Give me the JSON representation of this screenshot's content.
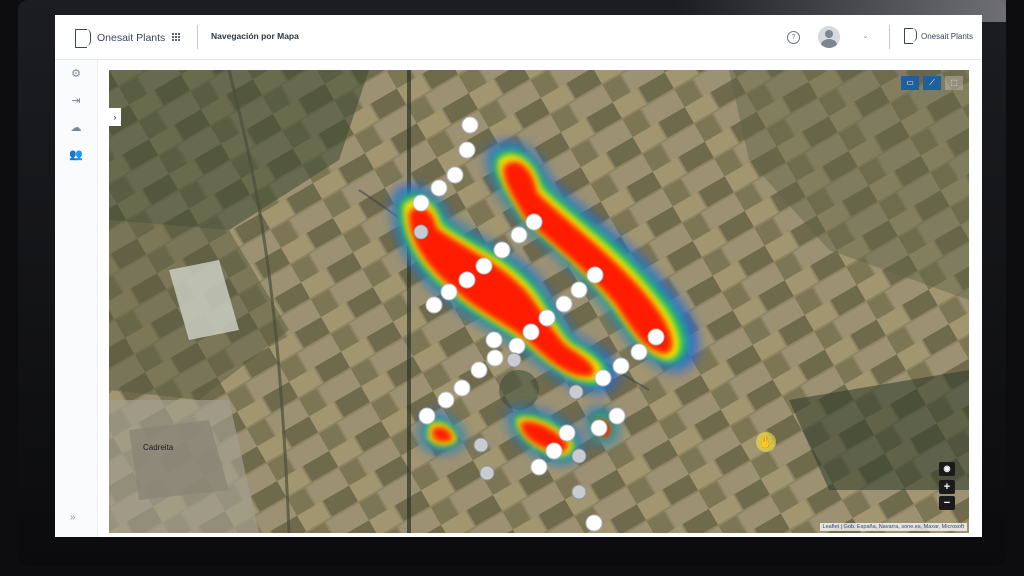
{
  "app": {
    "brand_name": "Onesait Plants",
    "page_title": "Navegación por Mapa",
    "brand_name_right": "Onesait Plants",
    "help_glyph": "?",
    "chevron_glyph": "⌄"
  },
  "sidebar": {
    "items": [
      {
        "icon": "plants-icon",
        "glyph": "⚙"
      },
      {
        "icon": "export-icon",
        "glyph": "⇥"
      },
      {
        "icon": "cloud-sync-icon",
        "glyph": "☁"
      },
      {
        "icon": "users-icon",
        "glyph": "👥"
      }
    ],
    "expand_glyph": "»"
  },
  "map": {
    "collapse_glyph": "›",
    "tools": [
      {
        "name": "monitor-tool-icon",
        "glyph": "▭",
        "active": true
      },
      {
        "name": "draw-line-tool-icon",
        "glyph": "⟋",
        "active": true
      },
      {
        "name": "select-area-tool-icon",
        "glyph": "⬚",
        "active": false
      }
    ],
    "zoom_in_label": "+",
    "zoom_out_label": "−",
    "eye_glyph": "◉",
    "town_label": "Cadreita",
    "attribution": "Leaflet | Gob. España, Navarra, sone.es, Maxar, Microsoft",
    "hand_glyph": "✋"
  },
  "colors": {
    "heat_red": "#ff1a00",
    "heat_yellow": "#f5e400",
    "heat_green": "#2fd24a",
    "heat_blue": "#1a4fff",
    "accent_blue": "#1f5f9a"
  }
}
